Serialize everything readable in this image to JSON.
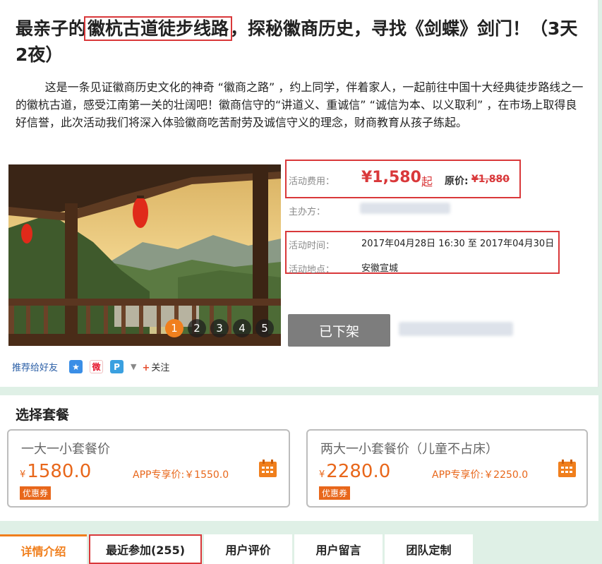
{
  "title": {
    "prefix": "最亲子的",
    "highlight": "徽杭古道徒步线路",
    "suffix": "，探秘徽商历史，寻找《剑蝶》剑门！（3天2夜）"
  },
  "description": "这是一条见证徽商历史文化的神奇 “徽商之路” ，约上同学，伴着家人，一起前往中国十大经典徒步路线之一的徽杭古道，感受江南第一关的壮阔吧！徽商信守的“讲道义、重诚信” “诚信为本、以义取利” ，在市场上取得良好信誉，此次活动我们将深入体验徽商吃苦耐劳及诚信守义的理念，财商教育从孩子练起。",
  "gallery": {
    "pages": [
      "1",
      "2",
      "3",
      "4",
      "5"
    ],
    "active_page": "1"
  },
  "info": {
    "fee_label": "活动费用：",
    "fee_value": "¥1,580",
    "fee_suffix": "起",
    "original_label": "原价:",
    "original_value": "¥1,880",
    "organizer_label": "主办方：",
    "time_label": "活动时间：",
    "time_value": "2017年04月28日 16:30 至 2017年04月30日",
    "place_label": "活动地点：",
    "place_value": "安徽宣城"
  },
  "status_button": "已下架",
  "share": {
    "recommend_label": "推荐给好友",
    "follow_label": "关注",
    "icons": [
      "qzone-star-icon",
      "weibo-icon",
      "tencent-weibo-icon",
      "chevron-down-icon"
    ]
  },
  "packages": {
    "heading": "选择套餐",
    "items": [
      {
        "name": "一大一小套餐价",
        "currency": "¥",
        "price": "1580.0",
        "app_price": "APP专享价:￥1550.0",
        "coupon": "优惠券"
      },
      {
        "name": "两大一小套餐价（儿童不占床）",
        "currency": "¥",
        "price": "2280.0",
        "app_price": "APP专享价:￥2250.0",
        "coupon": "优惠券"
      }
    ]
  },
  "tabs": [
    {
      "label": "详情介绍",
      "active": true
    },
    {
      "label": "最近参加(255)",
      "active": false
    },
    {
      "label": "用户评价",
      "active": false
    },
    {
      "label": "用户留言",
      "active": false
    },
    {
      "label": "团队定制",
      "active": false
    }
  ],
  "colors": {
    "accent_red": "#d9383a",
    "accent_orange": "#f07f1d",
    "price_orange": "#e8671b",
    "button_gray": "#7d7d7d",
    "page_bg": "#dff0e6"
  }
}
